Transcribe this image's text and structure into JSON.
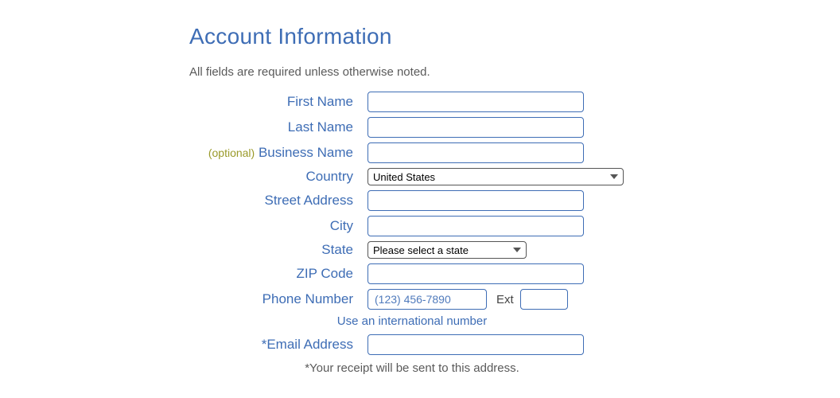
{
  "heading": "Account Information",
  "subtitle": "All fields are required unless otherwise noted.",
  "optional_text": "(optional)",
  "labels": {
    "first_name": "First Name",
    "last_name": "Last Name",
    "business_name": "Business Name",
    "country": "Country",
    "street_address": "Street Address",
    "city": "City",
    "state": "State",
    "zip": "ZIP Code",
    "phone": "Phone Number",
    "ext": "Ext",
    "email": "*Email Address"
  },
  "values": {
    "country_selected": "United States",
    "state_selected": "Please select a state",
    "phone_placeholder": "(123) 456-7890"
  },
  "intl_link": "Use an international number",
  "receipt_note": "*Your receipt will be sent to this address."
}
